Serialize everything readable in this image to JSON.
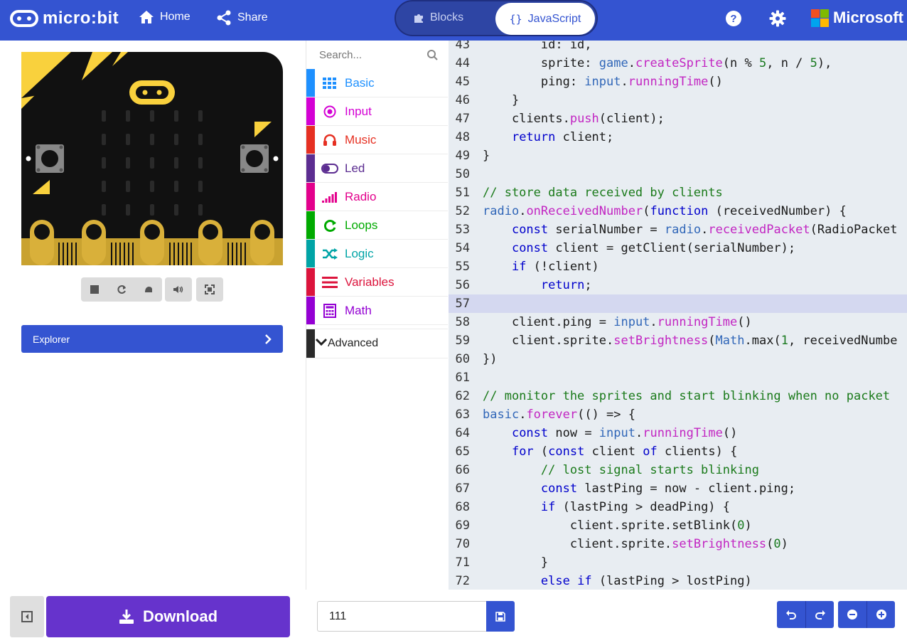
{
  "header": {
    "logo_text": "micro:bit",
    "home_label": "Home",
    "share_label": "Share",
    "mode_blocks": "Blocks",
    "mode_js": "JavaScript",
    "ms_label": "Microsoft",
    "colors": {
      "primary": "#3454d1",
      "toggle": "#2e45a4"
    }
  },
  "simulator": {
    "controls": [
      "stop-icon",
      "restart-icon",
      "debug-icon",
      "mute-icon",
      "fullscreen-icon"
    ]
  },
  "explorer": {
    "label": "Explorer"
  },
  "toolbox": {
    "search_placeholder": "Search...",
    "categories": [
      {
        "label": "Basic",
        "color": "#1e90ff",
        "icon": "grid-icon"
      },
      {
        "label": "Input",
        "color": "#d400d4",
        "icon": "target-icon"
      },
      {
        "label": "Music",
        "color": "#e63022",
        "icon": "headphones-icon"
      },
      {
        "label": "Led",
        "color": "#5c2d91",
        "icon": "toggle-icon"
      },
      {
        "label": "Radio",
        "color": "#e3008c",
        "icon": "signal-icon"
      },
      {
        "label": "Loops",
        "color": "#00aa00",
        "icon": "refresh-icon"
      },
      {
        "label": "Logic",
        "color": "#00a4a6",
        "icon": "shuffle-icon"
      },
      {
        "label": "Variables",
        "color": "#dc143c",
        "icon": "lines-icon"
      },
      {
        "label": "Math",
        "color": "#9400d3",
        "icon": "calculator-icon"
      }
    ],
    "advanced": "Advanced"
  },
  "editor": {
    "lines": [
      {
        "n": "43",
        "code": "        id: id,"
      },
      {
        "n": "44",
        "code": "        sprite: game.createSprite(n % 5, n / 5),"
      },
      {
        "n": "45",
        "code": "        ping: input.runningTime()"
      },
      {
        "n": "46",
        "code": "    }"
      },
      {
        "n": "47",
        "code": "    clients.push(client);"
      },
      {
        "n": "48",
        "code": "    return client;"
      },
      {
        "n": "49",
        "code": "}"
      },
      {
        "n": "50",
        "code": ""
      },
      {
        "n": "51",
        "code": "// store data received by clients"
      },
      {
        "n": "52",
        "code": "radio.onReceivedNumber(function (receivedNumber) {"
      },
      {
        "n": "53",
        "code": "    const serialNumber = radio.receivedPacket(RadioPacket"
      },
      {
        "n": "54",
        "code": "    const client = getClient(serialNumber);"
      },
      {
        "n": "55",
        "code": "    if (!client)"
      },
      {
        "n": "56",
        "code": "        return;"
      },
      {
        "n": "57",
        "code": ""
      },
      {
        "n": "58",
        "code": "    client.ping = input.runningTime()"
      },
      {
        "n": "59",
        "code": "    client.sprite.setBrightness(Math.max(1, receivedNumbe"
      },
      {
        "n": "60",
        "code": "})"
      },
      {
        "n": "61",
        "code": ""
      },
      {
        "n": "62",
        "code": "// monitor the sprites and start blinking when no packet"
      },
      {
        "n": "63",
        "code": "basic.forever(() => {"
      },
      {
        "n": "64",
        "code": "    const now = input.runningTime()"
      },
      {
        "n": "65",
        "code": "    for (const client of clients) {"
      },
      {
        "n": "66",
        "code": "        // lost signal starts blinking"
      },
      {
        "n": "67",
        "code": "        const lastPing = now - client.ping;"
      },
      {
        "n": "68",
        "code": "        if (lastPing > deadPing) {"
      },
      {
        "n": "69",
        "code": "            client.sprite.setBlink(0)"
      },
      {
        "n": "70",
        "code": "            client.sprite.setBrightness(0)"
      },
      {
        "n": "71",
        "code": "        }"
      },
      {
        "n": "72",
        "code": "        else if (lastPing > lostPing)"
      }
    ],
    "highlighted_line": "57"
  },
  "bottom": {
    "download_label": "Download",
    "project_name": "111",
    "download_color": "#6633cc"
  }
}
